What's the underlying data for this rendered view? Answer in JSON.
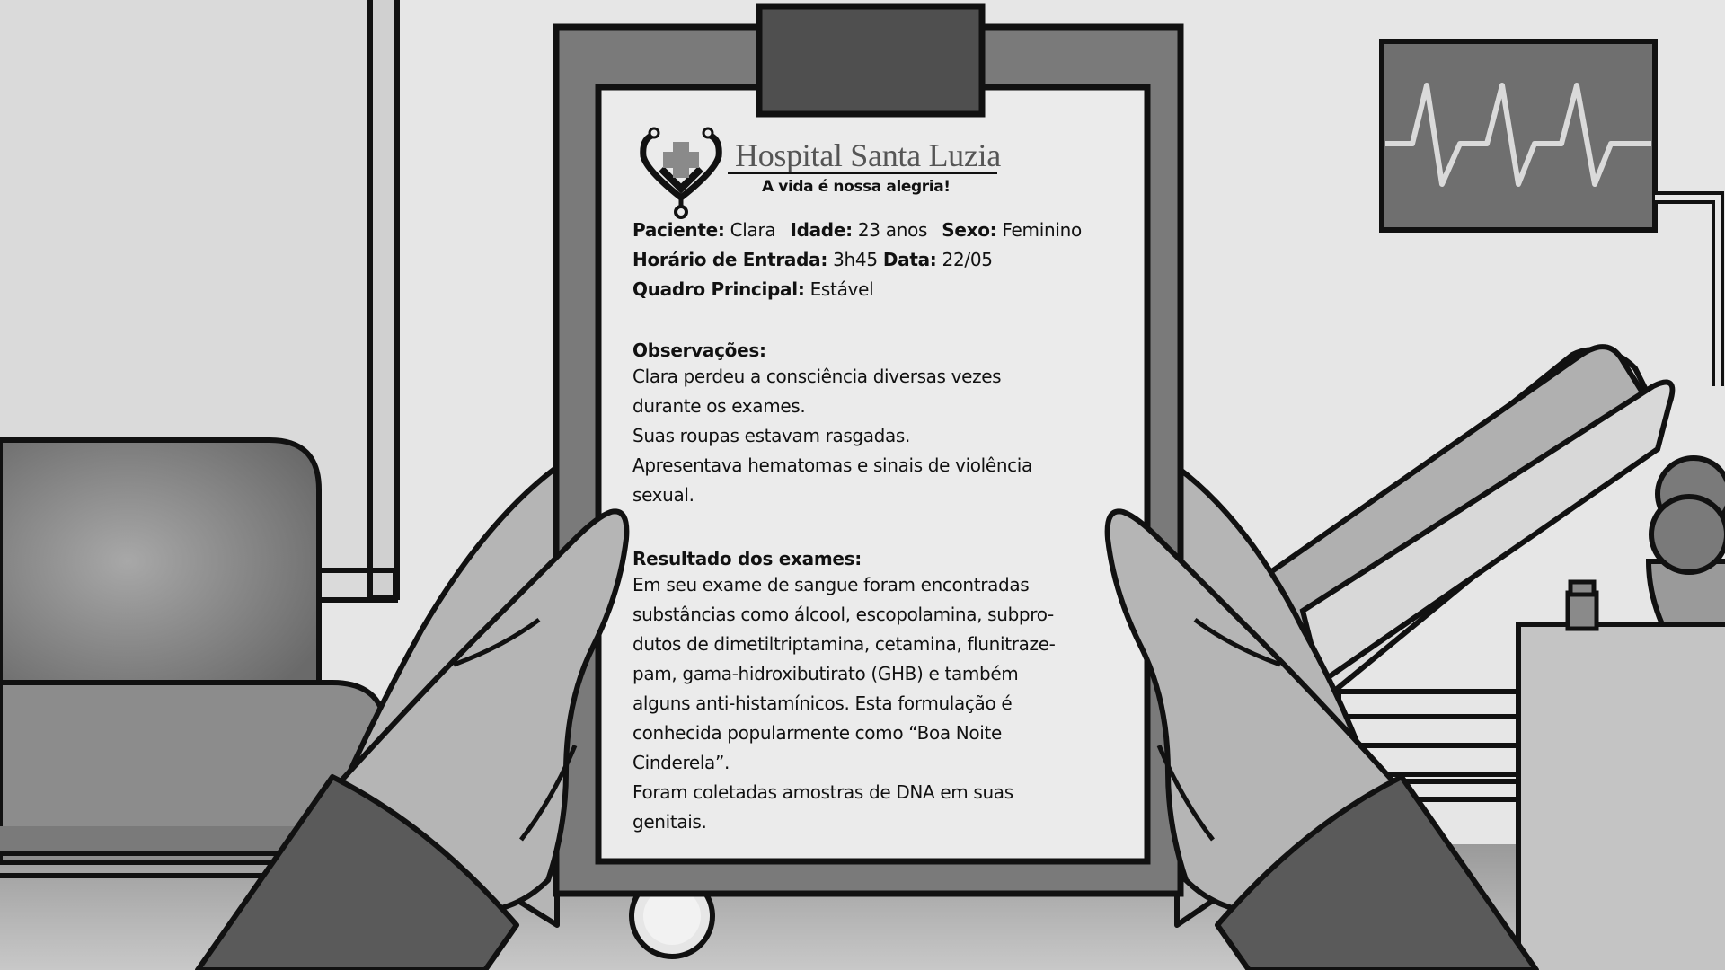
{
  "document": {
    "hospital_name": "Hospital Santa Luzia",
    "tagline": "A vida é nossa alegria!",
    "logo_icon": "stethoscope-heart-cross-icon",
    "patient_label": "Paciente:",
    "patient_value": "Clara",
    "age_label": "Idade:",
    "age_value": "23 anos",
    "sex_label": "Sexo:",
    "sex_value": "Feminino",
    "entry_label": "Horário de Entrada:",
    "entry_value": "3h45",
    "date_label": "Data:",
    "date_value": "22/05",
    "condition_label": "Quadro Principal:",
    "condition_value": "Estável",
    "observations_heading": "Observações:",
    "observations_text": "Clara perdeu a consciência diversas vezes\ndurante os exames.\nSuas roupas estavam rasgadas.\nApresentava hematomas e sinais de violência\nsexual.",
    "results_heading": "Resultado dos exames:",
    "results_text": "Em seu exame de sangue foram encontradas\nsubstâncias como álcool, escopolamina, subpro-\ndutos de dimetiltriptamina,  cetamina, flunitraze-\npam, gama-hidroxibutirato (GHB) e também\nalguns anti-histamínicos. Esta formulação é\nconhecida popularmente como “Boa Noite\nCinderela”.\nForam coletadas amostras de DNA em suas\ngenitais."
  },
  "scene": {
    "monitor_icon": "heart-monitor-icon",
    "colors": {
      "paper": "#ebebeb",
      "clipboard": "#7a7a7a",
      "clip": "#4f4f4f",
      "gloves": "#b5b5b5",
      "sleeves": "#5a5a5a",
      "outline": "#111111"
    }
  }
}
